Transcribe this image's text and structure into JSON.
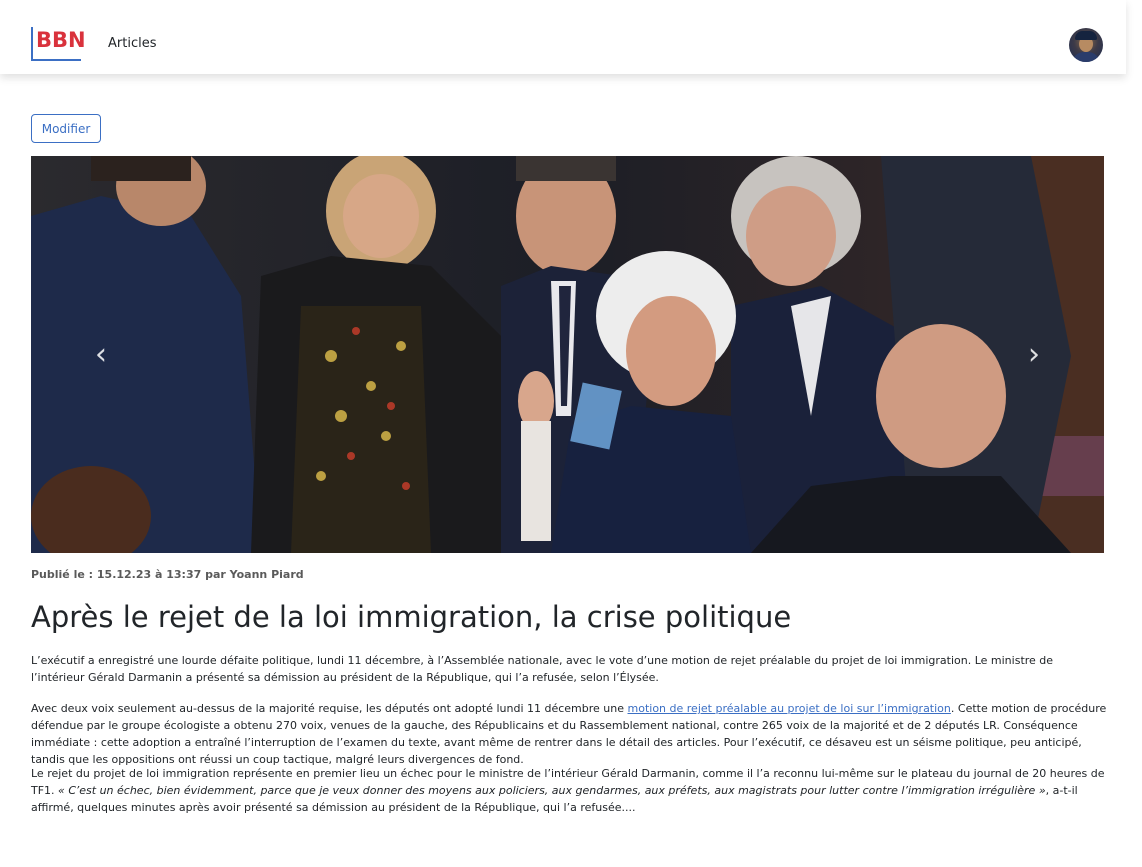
{
  "header": {
    "brand": "BBN",
    "nav_articles": "Articles"
  },
  "actions": {
    "edit_label": "Modifier"
  },
  "carousel": {
    "prev_icon": "‹",
    "next_icon": "›"
  },
  "article": {
    "meta": "Publié le : 15.12.23 à 13:37 par Yoann Piard",
    "title": "Après le rejet de la loi immigration, la crise politique",
    "p1": "L’exécutif a enregistré une lourde défaite politique, lundi 11 décembre, à l’Assemblée nationale, avec le vote d’une motion de rejet préalable du projet de loi immigration. Le ministre de l’intérieur Gérald Darmanin a présenté sa démission au président de la République, qui l’a refusée, selon l’Élysée.",
    "p2_before": "Avec deux voix seulement au-dessus de la majorité requise, les députés ont adopté lundi 11 décembre une ",
    "p2_link": "motion de rejet préalable au projet de loi sur l’immigration",
    "p2_after": ". Cette motion de procédure défendue par le groupe écologiste a obtenu 270 voix, venues de la gauche, des Républicains et du Rassemblement national, contre 265 voix de la majorité et de 2 députés LR. Conséquence immédiate : cette adoption a entraîné l’interruption de l’examen du texte, avant même de rentrer dans le détail des articles. Pour l’exécutif, ce désaveu est un séisme politique, peu anticipé, tandis que les oppositions ont réussi un coup tactique, malgré leurs divergences de fond.",
    "p3_before": "Le rejet du projet de loi immigration représente en premier lieu un échec pour le ministre de l’intérieur Gérald Darmanin, comme il l’a reconnu lui-même sur le plateau du journal de 20 heures de TF1. ",
    "p3_quote": "« C’est un échec, bien évidemment, parce que je veux donner des moyens aux policiers, aux gendarmes, aux préfets, aux magistrats pour lutter contre l’immigration irrégulière »",
    "p3_after": ", a-t-il affirmé, quelques minutes après avoir présenté sa démission au président de la République, qui l’a refusée...."
  }
}
